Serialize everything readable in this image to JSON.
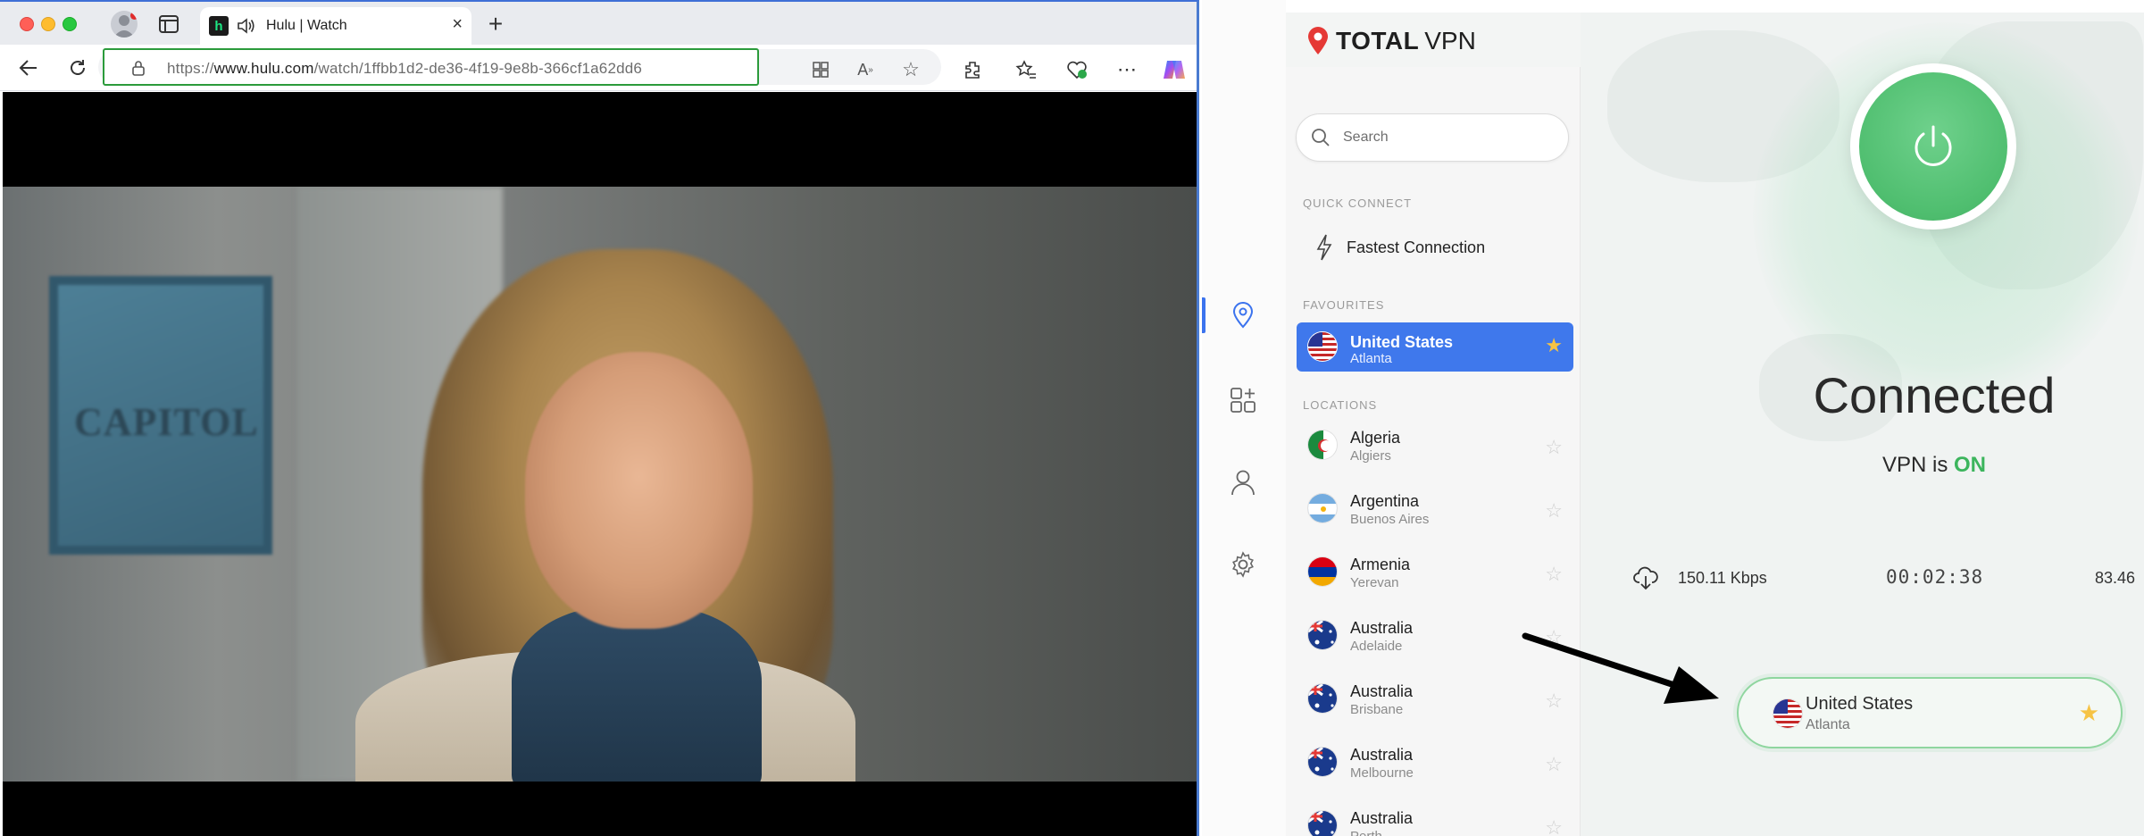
{
  "browser": {
    "tab": {
      "favicon": "h",
      "title": "Hulu | Watch"
    },
    "address": {
      "prefix": "https://",
      "host": "www.hulu.com",
      "path": "/watch/1ffbb1d2-de36-4f19-9e8b-366cf1a62dd6"
    },
    "video": {
      "sign_text": "CAPITOL"
    },
    "icons": [
      "profile-icon",
      "tab-actions-icon",
      "speaker-icon",
      "close-icon",
      "new-tab-icon",
      "back-icon",
      "reload-icon",
      "lock-icon",
      "app-icon",
      "read-aloud-icon",
      "favorite-star-icon",
      "extensions-icon",
      "favorites-icon",
      "browser-essentials-icon",
      "more-icon",
      "copilot-icon"
    ]
  },
  "vpn": {
    "logo": {
      "brand": "TOTAL",
      "product": "VPN"
    },
    "search": {
      "placeholder": "Search"
    },
    "sections": {
      "quick_connect": "QUICK CONNECT",
      "favourites": "FAVOURITES",
      "locations": "LOCATIONS"
    },
    "quick_connect": {
      "label": "Fastest Connection"
    },
    "favourites": [
      {
        "country": "United States",
        "city": "Atlanta"
      }
    ],
    "locations": [
      {
        "country": "Algeria",
        "city": "Algiers"
      },
      {
        "country": "Argentina",
        "city": "Buenos Aires"
      },
      {
        "country": "Armenia",
        "city": "Yerevan"
      },
      {
        "country": "Australia",
        "city": "Adelaide"
      },
      {
        "country": "Australia",
        "city": "Brisbane"
      },
      {
        "country": "Australia",
        "city": "Melbourne"
      },
      {
        "country": "Australia",
        "city": "Perth"
      }
    ],
    "status": {
      "title": "Connected",
      "vpn_is": "VPN is",
      "on": "ON",
      "download_speed": "150.11 Kbps",
      "timer": "00:02:38",
      "upload_speed": "83.46"
    },
    "current_server": {
      "country": "United States",
      "city": "Atlanta"
    },
    "colors": {
      "accent_blue": "#3f78ec",
      "connected_green": "#4fbe6f",
      "on_green": "#3cb55d",
      "star_gold": "#f6c344"
    }
  }
}
